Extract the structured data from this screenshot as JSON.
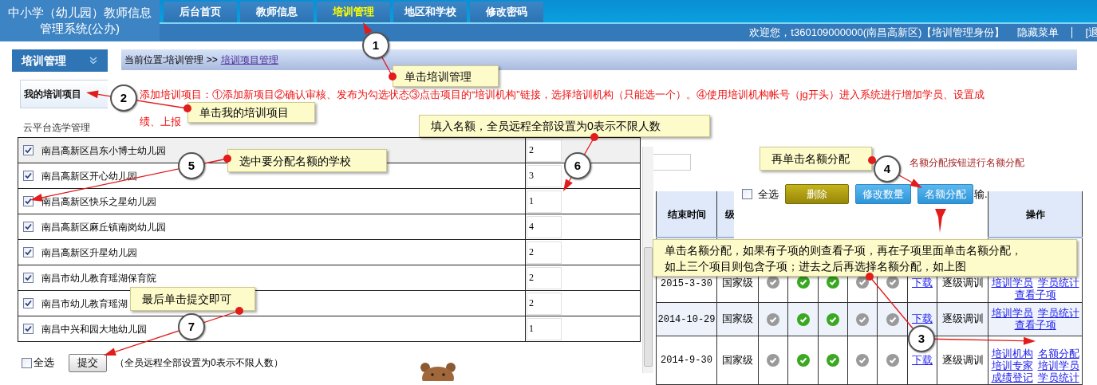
{
  "header": {
    "title": [
      "中小学（幼儿园）教师信息",
      "管理系统(公办)"
    ],
    "tabs": [
      {
        "label": "后台首页",
        "selected": false
      },
      {
        "label": "教师信息",
        "selected": false
      },
      {
        "label": "培训管理",
        "selected": true
      },
      {
        "label": "地区和学校",
        "selected": false
      },
      {
        "label": "修改密码",
        "selected": false
      }
    ],
    "welcome": "欢迎您，t360109000000(南昌高新区)【培训管理身份】",
    "hide_menu": "隐藏菜单",
    "logout": "[退"
  },
  "sidebar": {
    "title": "培训管理",
    "items": [
      {
        "label": "我的培训项目",
        "selected": true
      },
      {
        "label": "云平台选学管理",
        "selected": false
      }
    ]
  },
  "breadcrumb": {
    "path": "当前位置:培训管理 >>",
    "link": "培训项目管理"
  },
  "notice_lines": [
    "添加培训项目：①添加新项目②确认审核、发布为勾选状态③点击项目的“培训机构”链接，选择培训机构（只能选一个）。④使用培训机构帐号（jg开头）进入系统进行增加学员、设置成",
    "绩、上报"
  ],
  "toolbar": {
    "hint": "名额分配按钮进行名额分配",
    "select_all": {
      "label": "全选",
      "checked": false
    },
    "buttons": [
      {
        "label": "删除",
        "kind": "olive"
      },
      {
        "label": "修改数量",
        "kind": "blue"
      },
      {
        "label": "名额分配",
        "kind": "blue"
      }
    ],
    "trailing": "输."
  },
  "table": {
    "columns": [
      "结束时间",
      "级"
    ],
    "action_column": "操作",
    "rows": [
      {
        "end_date": "2015-3-30",
        "level": "国家级",
        "statuses": [
          {
            "on": false
          },
          {
            "on": true
          },
          {
            "on": true
          },
          {
            "on": false
          },
          {
            "on": false
          }
        ],
        "download": "下载",
        "mode": "逐级调训",
        "actions": [
          [
            "培训学员",
            "学员统计"
          ],
          [
            "查看子项"
          ]
        ]
      },
      {
        "end_date": "2014-10-29",
        "level": "国家级",
        "statuses": [
          {
            "on": false
          },
          {
            "on": true
          },
          {
            "on": true
          },
          {
            "on": false
          },
          {
            "on": false
          }
        ],
        "download": "下载",
        "mode": "逐级调训",
        "actions": [
          [
            "培训学员",
            "学员统计"
          ],
          [
            "查看子项"
          ]
        ]
      },
      {
        "end_date": "2014-9-30",
        "level": "国家级",
        "statuses": [
          {
            "on": false
          },
          {
            "on": true
          },
          {
            "on": true
          },
          {
            "on": false
          },
          {
            "on": false
          }
        ],
        "download": "下载",
        "mode": "逐级调训",
        "actions": [
          [
            "培训机构",
            "名额分配"
          ],
          [
            "培训专家",
            "培训学员"
          ],
          [
            "成绩登记",
            "学员统计"
          ]
        ]
      }
    ]
  },
  "dialog": {
    "rows": [
      {
        "school": "南昌高新区昌东小博士幼儿园",
        "checked": true,
        "quota": "2"
      },
      {
        "school": "南昌高新区开心幼儿园",
        "checked": true,
        "quota": "3"
      },
      {
        "school": "南昌高新区快乐之星幼儿园",
        "checked": true,
        "quota": "1"
      },
      {
        "school": "南昌高新区麻丘镇南岗幼儿园",
        "checked": true,
        "quota": "4"
      },
      {
        "school": "南昌高新区升星幼儿园",
        "checked": true,
        "quota": "2"
      },
      {
        "school": "南昌市幼儿教育瑶湖保育院",
        "checked": true,
        "quota": "2"
      },
      {
        "school": "南昌市幼儿教育瑶湖",
        "checked": true,
        "quota": "2"
      },
      {
        "school": "南昌中兴和园大地幼儿园",
        "checked": true,
        "quota": "1"
      }
    ],
    "select_all": {
      "label": "全选",
      "checked": false
    },
    "submit": "提交",
    "note": "（全员远程全部设置为0表示不限人数）"
  },
  "annotations": [
    {
      "step": "1",
      "callout": [
        "单击培训管理"
      ]
    },
    {
      "step": "2",
      "callout": [
        "单击我的培训项目"
      ]
    },
    {
      "step": "5",
      "callout": [
        "选中要分配名额的学校"
      ]
    },
    {
      "step": "6",
      "callout": [
        "填入名额，全员远程全部设置为0表示不限人数"
      ]
    },
    {
      "step": "4",
      "callout": [
        "再单击名额分配"
      ]
    },
    {
      "step": "3",
      "callout": [
        "单击名额分配，如果有子项的则查看子项，再在子项里面单击名额分配，",
        "如上三个项目则包含子项；进去之后再选择名额分配，如上图"
      ]
    },
    {
      "step": "7",
      "callout": [
        "最后单击提交即可"
      ]
    }
  ]
}
